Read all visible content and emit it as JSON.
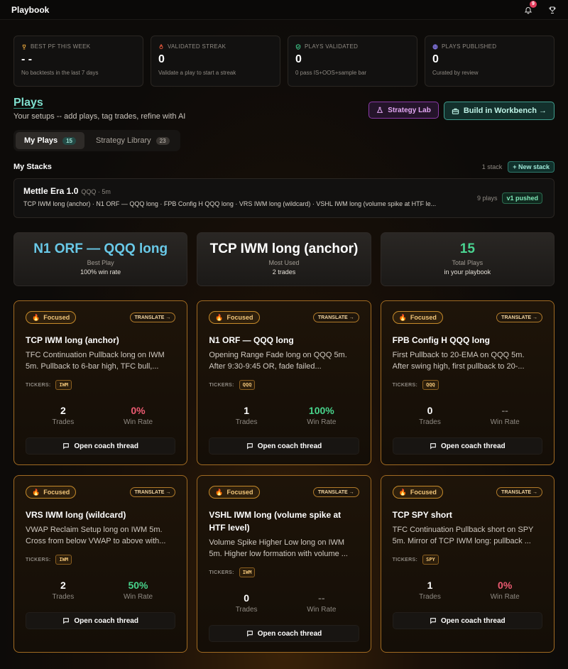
{
  "app": {
    "title": "Playbook",
    "notifications": "9"
  },
  "stats": [
    {
      "label": "BEST PF THIS WEEK",
      "value": "- -",
      "sub": "No backtests in the last 7 days",
      "icon": "trophy-icon",
      "color": "#e0a13a"
    },
    {
      "label": "VALIDATED STREAK",
      "value": "0",
      "sub": "Validate a play to start a streak",
      "icon": "flame-icon",
      "color": "#e0563a"
    },
    {
      "label": "PLAYS VALIDATED",
      "value": "0",
      "sub": "0 pass IS+OOS+sample bar",
      "icon": "shield-check-icon",
      "color": "#3ec98a"
    },
    {
      "label": "PLAYS PUBLISHED",
      "value": "0",
      "sub": "Curated by review",
      "icon": "globe-icon",
      "color": "#8a7cf0"
    }
  ],
  "plays": {
    "title": "Plays",
    "subtitle": "Your setups -- add plays, tag trades, refine with AI",
    "strategy_lab": "Strategy Lab",
    "workbench": "Build in Workbench →"
  },
  "tabs": [
    {
      "label": "My Plays",
      "count": "15"
    },
    {
      "label": "Strategy Library",
      "count": "23"
    }
  ],
  "stacks": {
    "title": "My Stacks",
    "count": "1 stack",
    "new": "+ New stack",
    "card": {
      "name": "Mettle Era 1.0",
      "meta": "QQQ · 5m",
      "desc": "TCP IWM long (anchor) · N1 ORF — QQQ long · FPB Config H QQQ long · VRS IWM long (wildcard) · VSHL IWM long (volume spike at HTF le...",
      "plays": "9 plays",
      "status": "v1 pushed"
    }
  },
  "highlights": [
    {
      "value": "N1 ORF — QQQ long",
      "label": "Best Play",
      "sub": "100% win rate"
    },
    {
      "value": "TCP IWM long (anchor)",
      "label": "Most Used",
      "sub": "2 trades"
    },
    {
      "value": "15",
      "label": "Total Plays",
      "sub": "in your playbook"
    }
  ],
  "labels": {
    "focused": "Focused",
    "translate": "TRANSLATE →",
    "tickers": "TICKERS:",
    "trades": "Trades",
    "win_rate": "Win Rate",
    "coach": "Open coach thread"
  },
  "cards": [
    {
      "name": "TCP IWM long (anchor)",
      "desc": "TFC Continuation Pullback long on IWM 5m. Pullback to 6-bar high, TFC bull,...",
      "ticker": "IWM",
      "trades": "2",
      "win_rate": "0%"
    },
    {
      "name": "N1 ORF — QQQ long",
      "desc": "Opening Range Fade long on QQQ 5m. After 9:30-9:45 OR, fade failed...",
      "ticker": "QQQ",
      "trades": "1",
      "win_rate": "100%"
    },
    {
      "name": "FPB Config H QQQ long",
      "desc": "First Pullback to 20-EMA on QQQ 5m. After swing high, first pullback to 20-...",
      "ticker": "QQQ",
      "trades": "0",
      "win_rate": "--"
    },
    {
      "name": "VRS IWM long (wildcard)",
      "desc": "VWAP Reclaim Setup long on IWM 5m. Cross from below VWAP to above with...",
      "ticker": "IWM",
      "trades": "2",
      "win_rate": "50%"
    },
    {
      "name": "VSHL IWM long (volume spike at HTF level)",
      "desc": "Volume Spike Higher Low long on IWM 5m. Higher low formation with volume ...",
      "ticker": "IWM",
      "trades": "0",
      "win_rate": "--"
    },
    {
      "name": "TCP SPY short",
      "desc": "TFC Continuation Pullback short on SPY 5m. Mirror of TCP IWM long: pullback ...",
      "ticker": "SPY",
      "trades": "1",
      "win_rate": "0%"
    }
  ]
}
